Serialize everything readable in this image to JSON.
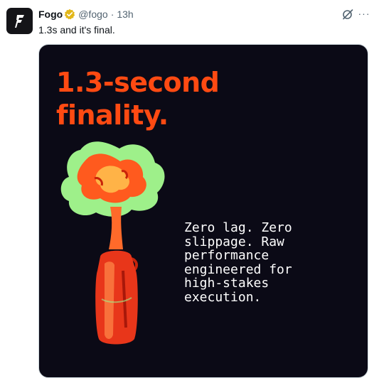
{
  "tweet": {
    "author_name": "Fogo",
    "handle": "@fogo",
    "separator": "·",
    "time": "13h",
    "text": "1.3s and it's final.",
    "more_label": "···"
  },
  "media": {
    "headline_lines": [
      "1.3-second",
      "finality."
    ],
    "body_lines": [
      "Zero lag. Zero",
      "slippage. Raw",
      "performance",
      "engineered for",
      "high-stakes",
      "execution."
    ]
  },
  "colors": {
    "accent": "#ff4a12",
    "media_bg": "#0b0a16",
    "verified_badge": "#e2b719",
    "muted_text": "#536471"
  },
  "icons": [
    "fogo-logo-icon",
    "verified-badge-icon",
    "grok-icon",
    "more-icon"
  ]
}
